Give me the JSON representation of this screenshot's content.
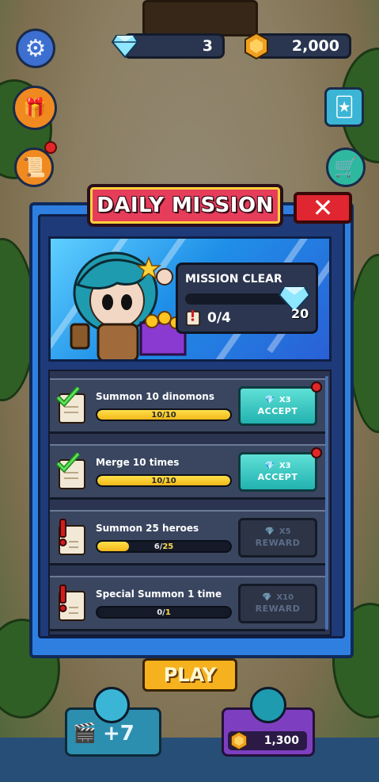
{
  "hud": {
    "gems": "3",
    "coins": "2,000"
  },
  "dialog": {
    "title": "DAILY MISSION",
    "close_label": "✕",
    "mission_clear": {
      "title": "MISSION CLEAR",
      "count": "0/4",
      "reward": "20",
      "progress": 0
    },
    "missions": [
      {
        "label": "Summon 10 dinomons",
        "current": "10",
        "total": "10",
        "progress": 1.0,
        "multiplier": "X3",
        "button": "ACCEPT",
        "state": "complete"
      },
      {
        "label": "Merge 10 times",
        "current": "10",
        "total": "10",
        "progress": 1.0,
        "multiplier": "X3",
        "button": "ACCEPT",
        "state": "complete"
      },
      {
        "label": "Summon 25 heroes",
        "current": "6",
        "total": "25",
        "progress": 0.24,
        "multiplier": "X5",
        "button": "REWARD",
        "state": "incomplete"
      },
      {
        "label": "Special Summon 1 time",
        "current": "0",
        "total": "1",
        "progress": 0,
        "multiplier": "X10",
        "button": "REWARD",
        "state": "incomplete"
      }
    ]
  },
  "bottom": {
    "play_label": "PLAY",
    "ad_reward": "+7",
    "shop_price": "1,300"
  },
  "colors": {
    "dialog_blue": "#2f7fe0",
    "accept_teal": "#22b2b0",
    "title_red": "#e63d5a",
    "progress_yellow": "#f2b81a"
  }
}
